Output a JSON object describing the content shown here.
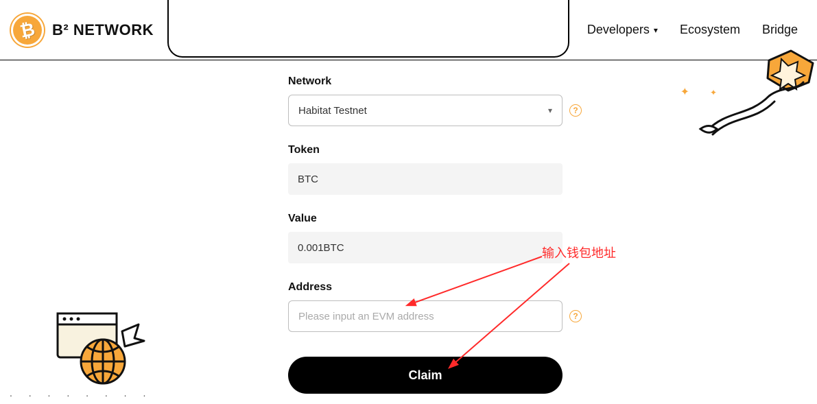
{
  "header": {
    "brand": "B² NETWORK",
    "nav": {
      "developers": "Developers",
      "ecosystem": "Ecosystem",
      "bridge": "Bridge"
    }
  },
  "form": {
    "network": {
      "label": "Network",
      "selected": "Habitat Testnet"
    },
    "token": {
      "label": "Token",
      "value": "BTC"
    },
    "value": {
      "label": "Value",
      "value": "0.001BTC"
    },
    "address": {
      "label": "Address",
      "placeholder": "Please input an EVM address"
    },
    "claim_label": "Claim"
  },
  "annotations": {
    "input_wallet_address": "输入钱包地址"
  },
  "help_glyph": "?",
  "dots": ". . . . . . . ."
}
